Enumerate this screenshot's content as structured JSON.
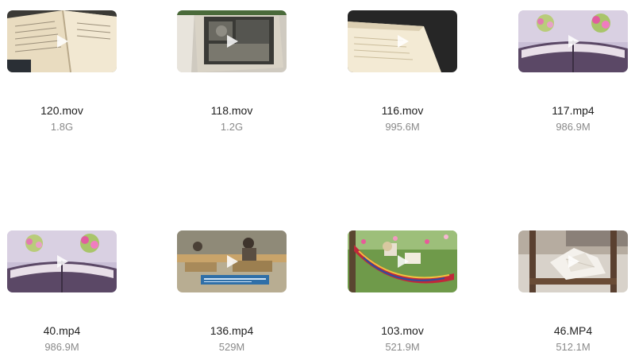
{
  "files": [
    {
      "name": "120.mov",
      "size": "1.8G",
      "thumb": "open-book-pages"
    },
    {
      "name": "118.mov",
      "size": "1.2G",
      "thumb": "book-with-photo"
    },
    {
      "name": "116.mov",
      "size": "995.6M",
      "thumb": "book-on-dark"
    },
    {
      "name": "117.mp4",
      "size": "986.9M",
      "thumb": "book-with-flowers"
    },
    {
      "name": "40.mp4",
      "size": "986.9M",
      "thumb": "book-with-flowers"
    },
    {
      "name": "136.mp4",
      "size": "529M",
      "thumb": "reading-room"
    },
    {
      "name": "103.mov",
      "size": "521.9M",
      "thumb": "hammock-garden"
    },
    {
      "name": "46.MP4",
      "size": "512.1M",
      "thumb": "paper-on-table"
    }
  ],
  "colors": {
    "name_text": "#1f1f1f",
    "size_text": "#8a8a8a",
    "play_icon": "#ffffff"
  }
}
